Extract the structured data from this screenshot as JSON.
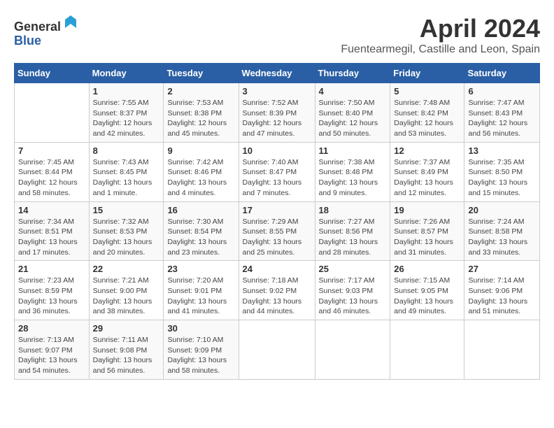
{
  "logo": {
    "general": "General",
    "blue": "Blue"
  },
  "title": "April 2024",
  "subtitle": "Fuentearmegil, Castille and Leon, Spain",
  "calendar": {
    "headers": [
      "Sunday",
      "Monday",
      "Tuesday",
      "Wednesday",
      "Thursday",
      "Friday",
      "Saturday"
    ],
    "weeks": [
      [
        {
          "day": "",
          "info": ""
        },
        {
          "day": "1",
          "info": "Sunrise: 7:55 AM\nSunset: 8:37 PM\nDaylight: 12 hours\nand 42 minutes."
        },
        {
          "day": "2",
          "info": "Sunrise: 7:53 AM\nSunset: 8:38 PM\nDaylight: 12 hours\nand 45 minutes."
        },
        {
          "day": "3",
          "info": "Sunrise: 7:52 AM\nSunset: 8:39 PM\nDaylight: 12 hours\nand 47 minutes."
        },
        {
          "day": "4",
          "info": "Sunrise: 7:50 AM\nSunset: 8:40 PM\nDaylight: 12 hours\nand 50 minutes."
        },
        {
          "day": "5",
          "info": "Sunrise: 7:48 AM\nSunset: 8:42 PM\nDaylight: 12 hours\nand 53 minutes."
        },
        {
          "day": "6",
          "info": "Sunrise: 7:47 AM\nSunset: 8:43 PM\nDaylight: 12 hours\nand 56 minutes."
        }
      ],
      [
        {
          "day": "7",
          "info": "Sunrise: 7:45 AM\nSunset: 8:44 PM\nDaylight: 12 hours\nand 58 minutes."
        },
        {
          "day": "8",
          "info": "Sunrise: 7:43 AM\nSunset: 8:45 PM\nDaylight: 13 hours\nand 1 minute."
        },
        {
          "day": "9",
          "info": "Sunrise: 7:42 AM\nSunset: 8:46 PM\nDaylight: 13 hours\nand 4 minutes."
        },
        {
          "day": "10",
          "info": "Sunrise: 7:40 AM\nSunset: 8:47 PM\nDaylight: 13 hours\nand 7 minutes."
        },
        {
          "day": "11",
          "info": "Sunrise: 7:38 AM\nSunset: 8:48 PM\nDaylight: 13 hours\nand 9 minutes."
        },
        {
          "day": "12",
          "info": "Sunrise: 7:37 AM\nSunset: 8:49 PM\nDaylight: 13 hours\nand 12 minutes."
        },
        {
          "day": "13",
          "info": "Sunrise: 7:35 AM\nSunset: 8:50 PM\nDaylight: 13 hours\nand 15 minutes."
        }
      ],
      [
        {
          "day": "14",
          "info": "Sunrise: 7:34 AM\nSunset: 8:51 PM\nDaylight: 13 hours\nand 17 minutes."
        },
        {
          "day": "15",
          "info": "Sunrise: 7:32 AM\nSunset: 8:53 PM\nDaylight: 13 hours\nand 20 minutes."
        },
        {
          "day": "16",
          "info": "Sunrise: 7:30 AM\nSunset: 8:54 PM\nDaylight: 13 hours\nand 23 minutes."
        },
        {
          "day": "17",
          "info": "Sunrise: 7:29 AM\nSunset: 8:55 PM\nDaylight: 13 hours\nand 25 minutes."
        },
        {
          "day": "18",
          "info": "Sunrise: 7:27 AM\nSunset: 8:56 PM\nDaylight: 13 hours\nand 28 minutes."
        },
        {
          "day": "19",
          "info": "Sunrise: 7:26 AM\nSunset: 8:57 PM\nDaylight: 13 hours\nand 31 minutes."
        },
        {
          "day": "20",
          "info": "Sunrise: 7:24 AM\nSunset: 8:58 PM\nDaylight: 13 hours\nand 33 minutes."
        }
      ],
      [
        {
          "day": "21",
          "info": "Sunrise: 7:23 AM\nSunset: 8:59 PM\nDaylight: 13 hours\nand 36 minutes."
        },
        {
          "day": "22",
          "info": "Sunrise: 7:21 AM\nSunset: 9:00 PM\nDaylight: 13 hours\nand 38 minutes."
        },
        {
          "day": "23",
          "info": "Sunrise: 7:20 AM\nSunset: 9:01 PM\nDaylight: 13 hours\nand 41 minutes."
        },
        {
          "day": "24",
          "info": "Sunrise: 7:18 AM\nSunset: 9:02 PM\nDaylight: 13 hours\nand 44 minutes."
        },
        {
          "day": "25",
          "info": "Sunrise: 7:17 AM\nSunset: 9:03 PM\nDaylight: 13 hours\nand 46 minutes."
        },
        {
          "day": "26",
          "info": "Sunrise: 7:15 AM\nSunset: 9:05 PM\nDaylight: 13 hours\nand 49 minutes."
        },
        {
          "day": "27",
          "info": "Sunrise: 7:14 AM\nSunset: 9:06 PM\nDaylight: 13 hours\nand 51 minutes."
        }
      ],
      [
        {
          "day": "28",
          "info": "Sunrise: 7:13 AM\nSunset: 9:07 PM\nDaylight: 13 hours\nand 54 minutes."
        },
        {
          "day": "29",
          "info": "Sunrise: 7:11 AM\nSunset: 9:08 PM\nDaylight: 13 hours\nand 56 minutes."
        },
        {
          "day": "30",
          "info": "Sunrise: 7:10 AM\nSunset: 9:09 PM\nDaylight: 13 hours\nand 58 minutes."
        },
        {
          "day": "",
          "info": ""
        },
        {
          "day": "",
          "info": ""
        },
        {
          "day": "",
          "info": ""
        },
        {
          "day": "",
          "info": ""
        }
      ]
    ]
  }
}
